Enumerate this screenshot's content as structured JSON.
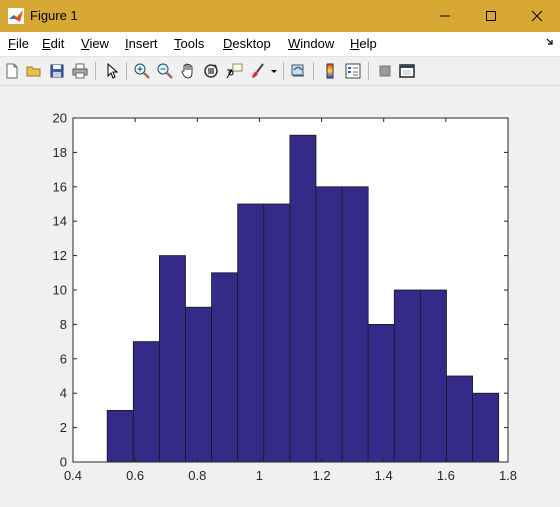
{
  "window": {
    "title": "Figure 1"
  },
  "menu": {
    "items": [
      {
        "label": "File"
      },
      {
        "label": "Edit"
      },
      {
        "label": "View"
      },
      {
        "label": "Insert"
      },
      {
        "label": "Tools"
      },
      {
        "label": "Desktop"
      },
      {
        "label": "Window"
      },
      {
        "label": "Help"
      }
    ]
  },
  "toolbar": {
    "buttons": [
      "new-figure-icon",
      "open-file-icon",
      "save-icon",
      "print-icon",
      "pointer-icon",
      "zoom-in-icon",
      "zoom-out-icon",
      "pan-icon",
      "rotate-3d-icon",
      "data-cursor-icon",
      "brush-icon",
      "link-plot-icon",
      "colorbar-icon",
      "legend-icon",
      "hide-plot-tools-icon",
      "show-plot-tools-icon"
    ]
  },
  "colors": {
    "titlebar": "#d8a835",
    "bar_fill": "#352a87",
    "bar_edge": "#1a1a1a"
  },
  "chart_data": {
    "type": "bar",
    "subtype": "histogram",
    "bin_edges": [
      0.51,
      0.594,
      0.678,
      0.762,
      0.846,
      0.93,
      1.014,
      1.098,
      1.182,
      1.266,
      1.35,
      1.434,
      1.518,
      1.602,
      1.686,
      1.77
    ],
    "values": [
      3,
      7,
      12,
      9,
      11,
      15,
      15,
      19,
      16,
      16,
      8,
      10,
      10,
      5,
      4
    ],
    "xlim": [
      0.4,
      1.8
    ],
    "ylim": [
      0,
      20
    ],
    "xticks": [
      "0.4",
      "0.6",
      "0.8",
      "1",
      "1.2",
      "1.4",
      "1.6",
      "1.8"
    ],
    "yticks": [
      "0",
      "2",
      "4",
      "6",
      "8",
      "10",
      "12",
      "14",
      "16",
      "18",
      "20"
    ],
    "title": "",
    "xlabel": "",
    "ylabel": "",
    "grid": false
  }
}
